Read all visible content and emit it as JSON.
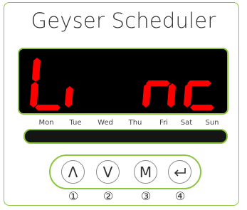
{
  "app": {
    "title": "Geyser Scheduler"
  },
  "display": {
    "segment_color": "#ff0000",
    "off_color": "#000000",
    "text_shown": "Li nc"
  },
  "days": [
    "Mon",
    "Tue",
    "Wed",
    "Thu",
    "Fri",
    "Sat",
    "Sun"
  ],
  "buttons": [
    {
      "label": "Λ",
      "icon": "up-chevron-icon",
      "number": "①"
    },
    {
      "label": "V",
      "icon": "down-chevron-icon",
      "number": "②"
    },
    {
      "label": "M",
      "icon": "mode-icon",
      "number": "③"
    },
    {
      "label": "",
      "icon": "enter-icon",
      "number": "④"
    }
  ],
  "colors": {
    "accent": "#8cc63f",
    "text": "#333333"
  }
}
